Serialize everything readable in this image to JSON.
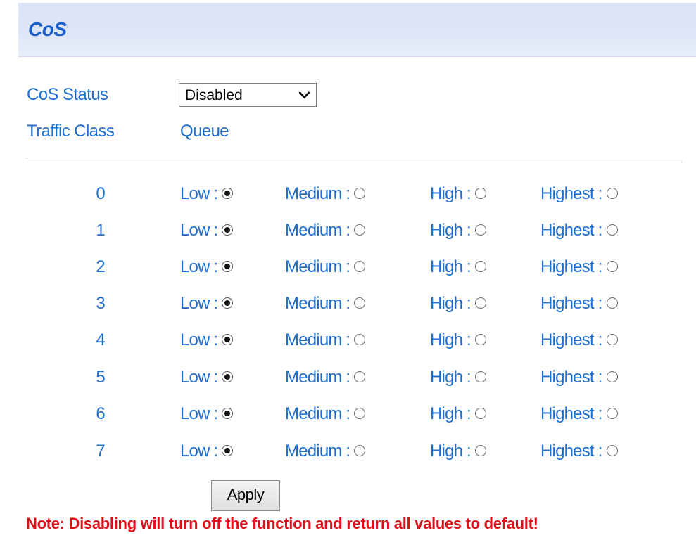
{
  "page": {
    "title": "CoS"
  },
  "settings": {
    "status_label": "CoS Status",
    "status_value": "Disabled",
    "status_icon": "chevron-down-icon",
    "traffic_class_header": "Traffic Class",
    "queue_header": "Queue"
  },
  "queue_options": [
    "Low",
    "Medium",
    "High",
    "Highest"
  ],
  "rows": [
    {
      "class": "0",
      "selected": "Low"
    },
    {
      "class": "1",
      "selected": "Low"
    },
    {
      "class": "2",
      "selected": "Low"
    },
    {
      "class": "3",
      "selected": "Low"
    },
    {
      "class": "4",
      "selected": "Low"
    },
    {
      "class": "5",
      "selected": "Low"
    },
    {
      "class": "6",
      "selected": "Low"
    },
    {
      "class": "7",
      "selected": "Low"
    }
  ],
  "apply_label": "Apply",
  "note": "Note: Disabling will turn off the function and return all values to default!",
  "colors": {
    "label_blue": "#1f6fd1",
    "title_blue": "#1a5fcb",
    "note_red": "#e0101a",
    "title_bar_bg": "#dde6f7"
  }
}
